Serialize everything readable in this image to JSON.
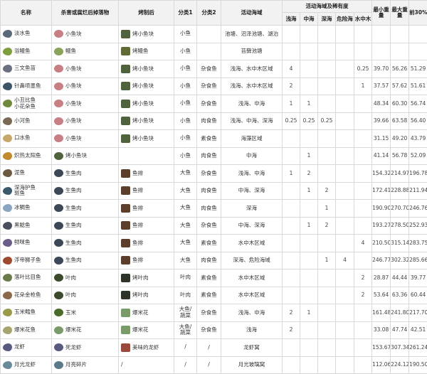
{
  "headers": {
    "name": "名称",
    "drop": "杀害或腐烂后掉落物",
    "cooked": "烤制后",
    "cat1": "分类1",
    "cat2": "分类2",
    "area": "活动海域",
    "sea_group": "活动海域及稀有度",
    "sea_cols": [
      "浅海",
      "中海",
      "深海",
      "危险海",
      "水中木"
    ],
    "min_w": "最小重量",
    "max_w": "最大重量",
    "top30": "前30%"
  },
  "rows": [
    {
      "name": "淡水鱼",
      "drop": "小鱼块",
      "cooked": "烤小鱼块",
      "c1": "小鱼",
      "c2": "",
      "area": "池塘、沼泽池塘、湖泊",
      "sea": [
        "",
        "",
        "",
        "",
        ""
      ],
      "min": "",
      "max": "",
      "top": "",
      "fishColor": "#5a6a78",
      "dropColor": "#c77f84",
      "cookColor": "#50613d"
    },
    {
      "name": "浴鳗鱼",
      "drop": "鳗鱼",
      "cooked": "烤鳗鱼",
      "c1": "小鱼",
      "c2": "",
      "area": "苔藓池塘",
      "sea": [
        "",
        "",
        "",
        "",
        ""
      ],
      "min": "",
      "max": "",
      "top": "",
      "fishColor": "#7f9e3c",
      "dropColor": "#8aa35b",
      "cookColor": "#5e6b34"
    },
    {
      "name": "三文鱼苗",
      "drop": "小鱼块",
      "cooked": "烤小鱼块",
      "c1": "小鱼",
      "c2": "杂食鱼",
      "area": "浅海、水中木区域",
      "sea": [
        "4",
        "",
        "",
        "",
        "0.25"
      ],
      "min": "39.70",
      "max": "56.26",
      "top": "51.29",
      "fishColor": "#6b6f80",
      "dropColor": "#c77f84",
      "cookColor": "#50613d"
    },
    {
      "name": "针鼻喷墨鱼",
      "drop": "小鱼块",
      "cooked": "烤小鱼块",
      "c1": "小鱼",
      "c2": "杂食鱼",
      "area": "浅海、水中木区域",
      "sea": [
        "2",
        "",
        "",
        "",
        "1"
      ],
      "min": "37.57",
      "max": "57.62",
      "top": "51.61",
      "fishColor": "#3d5366",
      "dropColor": "#c77f84",
      "cookColor": "#50613d"
    },
    {
      "name": "小丑比鱼\n小花朵鱼",
      "drop": "小鱼块",
      "cooked": "烤小鱼块",
      "c1": "小鱼",
      "c2": "杂食鱼",
      "area": "浅海、中海",
      "sea": [
        "1",
        "1",
        "",
        "",
        ""
      ],
      "min": "48.34",
      "max": "60.30",
      "top": "56.74",
      "fishColor": "#6f8a3b",
      "dropColor": "#c77f84",
      "cookColor": "#50613d"
    },
    {
      "name": "小河鱼",
      "drop": "小鱼块",
      "cooked": "烤小鱼块",
      "c1": "小鱼",
      "c2": "肉食鱼",
      "area": "浅海、中海、深海",
      "sea": [
        "0.25",
        "0.25",
        "0.25",
        "",
        ""
      ],
      "min": "39.66",
      "max": "63.58",
      "top": "56.40",
      "fishColor": "#7a6a55",
      "dropColor": "#c77f84",
      "cookColor": "#50613d"
    },
    {
      "name": "口水鱼",
      "drop": "小鱼块",
      "cooked": "烤小鱼块",
      "c1": "小鱼",
      "c2": "素食鱼",
      "area": "海藻区域",
      "sea": [
        "",
        "",
        "",
        "",
        ""
      ],
      "min": "31.15",
      "max": "49.20",
      "top": "43.79",
      "fishColor": "#c8a86a",
      "dropColor": "#c77f84",
      "cookColor": "#50613d"
    },
    {
      "name": "炽热太阳鱼",
      "drop": "烤小鱼块",
      "cooked": "",
      "c1": "小鱼",
      "c2": "肉食鱼",
      "area": "中海",
      "sea": [
        "",
        "1",
        "",
        "",
        ""
      ],
      "min": "41.14",
      "max": "56.78",
      "top": "52.09",
      "fishColor": "#c28a2e",
      "dropColor": "#50613d",
      "cookColor": ""
    },
    {
      "name": "泥鱼",
      "drop": "生鱼肉",
      "cooked": "鱼排",
      "c1": "大鱼",
      "c2": "杂食鱼",
      "area": "浅海、中海",
      "sea": [
        "1",
        "2",
        "",
        "",
        ""
      ],
      "min": "154.32",
      "max": "214.97",
      "top": "196.78",
      "fishColor": "#6e5a40",
      "dropColor": "#3c4858",
      "cookColor": "#5b3f2c"
    },
    {
      "name": "深海护鱼\n斑鱼",
      "drop": "生鱼肉",
      "cooked": "鱼排",
      "c1": "大鱼",
      "c2": "肉食鱼",
      "area": "中海、深海",
      "sea": [
        "",
        "1",
        "2",
        "",
        ""
      ],
      "min": "172.41",
      "max": "228.88",
      "top": "211.94",
      "fishColor": "#3a5a6c",
      "dropColor": "#3c4858",
      "cookColor": "#5b3f2c"
    },
    {
      "name": "冰鲷鱼",
      "drop": "生鱼肉",
      "cooked": "鱼排",
      "c1": "大鱼",
      "c2": "肉食鱼",
      "area": "深海",
      "sea": [
        "",
        "",
        "1",
        "",
        ""
      ],
      "min": "190.90",
      "max": "270.70",
      "top": "246.76",
      "fishColor": "#8aa6c0",
      "dropColor": "#3c4858",
      "cookColor": "#5b3f2c"
    },
    {
      "name": "黑鲶鱼",
      "drop": "生鱼肉",
      "cooked": "鱼排",
      "c1": "大鱼",
      "c2": "杂食鱼",
      "area": "中海、深海",
      "sea": [
        "",
        "1",
        "2",
        "",
        ""
      ],
      "min": "193.27",
      "max": "278.50",
      "top": "252.93",
      "fishColor": "#4a4f5e",
      "dropColor": "#3c4858",
      "cookColor": "#5b3f2c"
    },
    {
      "name": "鲟咪鱼",
      "drop": "生鱼肉",
      "cooked": "鱼排",
      "c1": "大鱼",
      "c2": "素食鱼",
      "area": "水中木区域",
      "sea": [
        "",
        "",
        "",
        "",
        "4"
      ],
      "min": "210.50",
      "max": "315.14",
      "top": "283.75",
      "fishColor": "#6c5c8a",
      "dropColor": "#3c4858",
      "cookColor": "#5b3f2c"
    },
    {
      "name": "浮帝狮子鱼",
      "drop": "生鱼肉",
      "cooked": "鱼排",
      "c1": "大鱼",
      "c2": "肉食鱼",
      "area": "深海、危险海域",
      "sea": [
        "",
        "",
        "1",
        "4",
        ""
      ],
      "min": "246.77",
      "max": "302.32",
      "top": "285.66",
      "fishColor": "#9b4a2e",
      "dropColor": "#3c4858",
      "cookColor": "#5b3f2c"
    },
    {
      "name": "落叶比目鱼",
      "drop": "叶肉",
      "cooked": "烤叶肉",
      "c1": "叶肉",
      "c2": "素食鱼",
      "area": "水中木区域",
      "sea": [
        "",
        "",
        "",
        "",
        "2"
      ],
      "min": "28.87",
      "max": "44.44",
      "top": "39.77",
      "fishColor": "#6a7a4a",
      "dropColor": "#3a4a2a",
      "cookColor": "#2e3528"
    },
    {
      "name": "花朵金枪鱼",
      "drop": "叶肉",
      "cooked": "烤叶肉",
      "c1": "叶肉",
      "c2": "素食鱼",
      "area": "水中木区域",
      "sea": [
        "",
        "",
        "",
        "",
        "2"
      ],
      "min": "53.64",
      "max": "63.36",
      "top": "60.44",
      "fishColor": "#8a6a4a",
      "dropColor": "#3a4a2a",
      "cookColor": "#2e3528"
    },
    {
      "name": "玉米鳕鱼",
      "drop": "玉米",
      "cooked": "爆米花",
      "c1": "大鱼/\n蔬菜",
      "c2": "杂食鱼",
      "area": "浅海、中海",
      "sea": [
        "2",
        "1",
        "",
        "",
        ""
      ],
      "min": "161.48",
      "max": "241.80",
      "top": "217.70",
      "fishColor": "#9a9a4a",
      "dropColor": "#4a6b2a",
      "cookColor": "#7a9a6a"
    },
    {
      "name": "爆米花鱼",
      "drop": "爆米花",
      "cooked": "爆米花",
      "c1": "大鱼/\n蔬菜",
      "c2": "杂食鱼",
      "area": "浅海",
      "sea": [
        "2",
        "",
        "",
        "",
        ""
      ],
      "min": "33.08",
      "max": "47.74",
      "top": "42.51",
      "fishColor": "#a8a470",
      "dropColor": "#7a9a6a",
      "cookColor": "#7a9a6a"
    },
    {
      "name": "龙虾",
      "drop": "死龙虾",
      "cooked": "美味的龙虾",
      "c1": "/",
      "c2": "/",
      "area": "龙虾窝",
      "sea": [
        "",
        "",
        "",
        "",
        ""
      ],
      "min": "153.67",
      "max": "307.34",
      "top": "261.24",
      "fishColor": "#5a5a80",
      "dropColor": "#5a5a80",
      "cookColor": "#9a4a3a"
    },
    {
      "name": "月光龙虾",
      "drop": "月亮碎片",
      "cooked": "/",
      "c1": "/",
      "c2": "/",
      "area": "月光玻璃窝",
      "sea": [
        "",
        "",
        "",
        "",
        ""
      ],
      "min": "112.06",
      "max": "224.12",
      "top": "190.50",
      "fishColor": "#6a8a9a",
      "dropColor": "#5a7a8a",
      "cookColor": ""
    }
  ]
}
